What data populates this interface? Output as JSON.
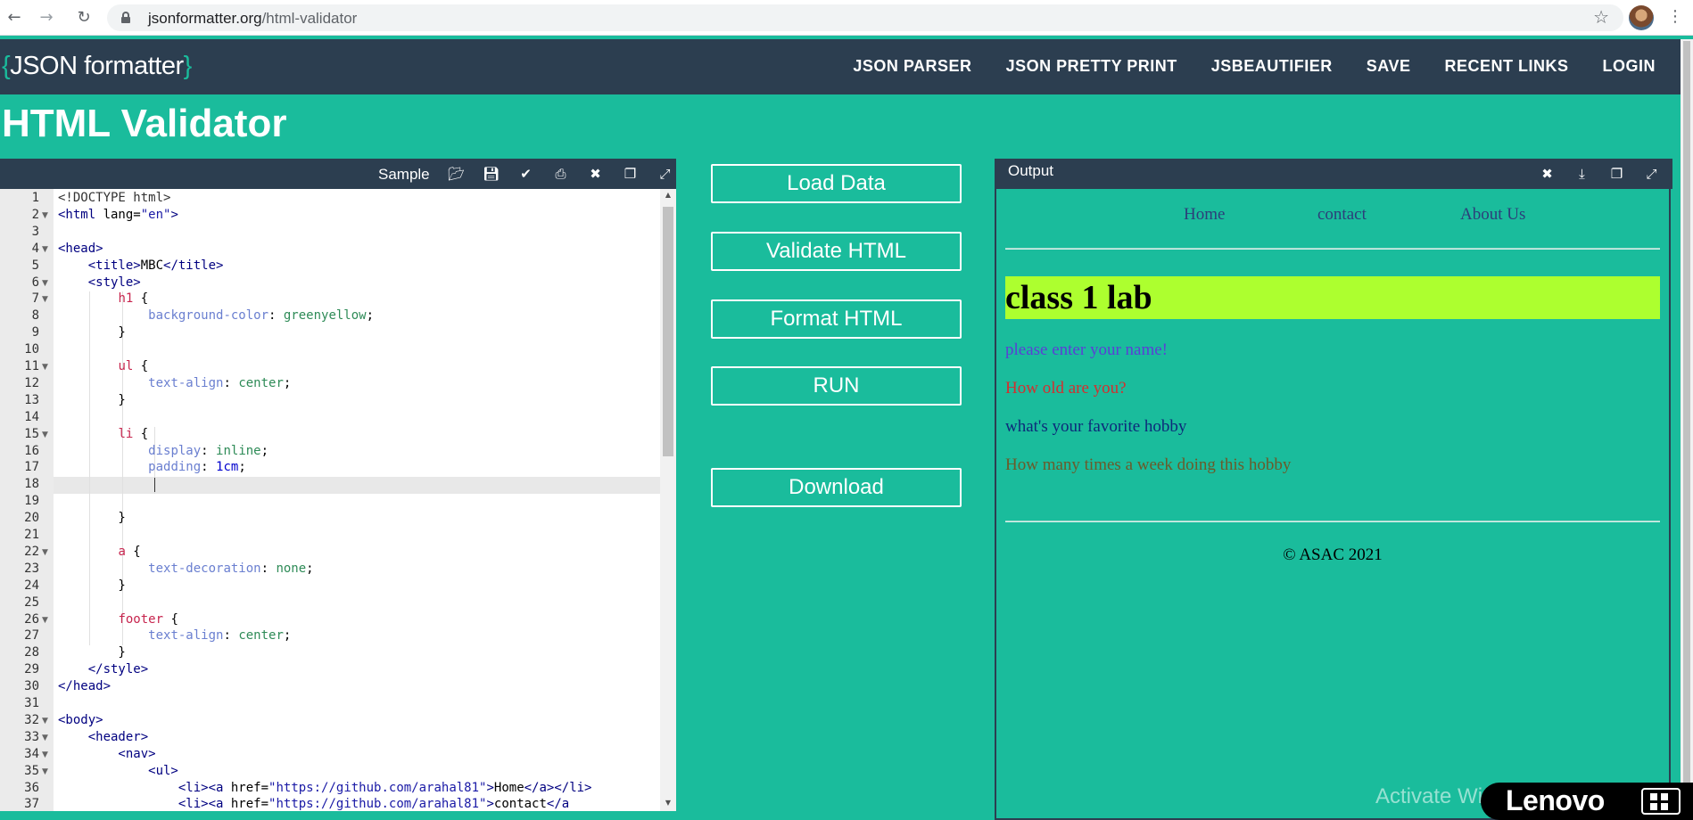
{
  "browser": {
    "url_domain": "jsonformatter.org",
    "url_path": "/html-validator"
  },
  "site": {
    "logo_open": "{",
    "logo_text": "JSON formatter",
    "logo_close": "}",
    "nav": [
      "JSON PARSER",
      "JSON PRETTY PRINT",
      "JSBEAUTIFIER",
      "SAVE",
      "RECENT LINKS",
      "LOGIN"
    ]
  },
  "page_title": "HTML Validator",
  "editor": {
    "toolbar_title": "Sample",
    "active_line": 18,
    "lines": [
      [
        [
          "t-doc",
          "<!DOCTYPE html>"
        ]
      ],
      [
        [
          "t-tag",
          "<html "
        ],
        [
          "t-attr",
          "lang="
        ],
        [
          "t-str",
          "\"en\""
        ],
        [
          "t-tag",
          ">"
        ]
      ],
      [],
      [
        [
          "t-tag",
          "<head>"
        ]
      ],
      [
        [
          "t-tag",
          "    <title>"
        ],
        [
          "t-attr",
          "MBC"
        ],
        [
          "t-tag",
          "</title>"
        ]
      ],
      [
        [
          "t-tag",
          "    <style>"
        ]
      ],
      [
        [
          "",
          "        "
        ],
        [
          "t-sel",
          "h1"
        ],
        [
          "t-attr",
          " {"
        ]
      ],
      [
        [
          "",
          "            "
        ],
        [
          "t-prop",
          "background-color"
        ],
        [
          "t-attr",
          ": "
        ],
        [
          "t-val",
          "greenyellow"
        ],
        [
          "t-attr",
          ";"
        ]
      ],
      [
        [
          "t-attr",
          "        }"
        ]
      ],
      [],
      [
        [
          "",
          "        "
        ],
        [
          "t-sel",
          "ul"
        ],
        [
          "t-attr",
          " {"
        ]
      ],
      [
        [
          "",
          "            "
        ],
        [
          "t-prop",
          "text-align"
        ],
        [
          "t-attr",
          ": "
        ],
        [
          "t-val",
          "center"
        ],
        [
          "t-attr",
          ";"
        ]
      ],
      [
        [
          "t-attr",
          "        }"
        ]
      ],
      [],
      [
        [
          "",
          "        "
        ],
        [
          "t-sel",
          "li"
        ],
        [
          "t-attr",
          " {"
        ]
      ],
      [
        [
          "",
          "            "
        ],
        [
          "t-prop",
          "display"
        ],
        [
          "t-attr",
          ": "
        ],
        [
          "t-val",
          "inline"
        ],
        [
          "t-attr",
          ";"
        ]
      ],
      [
        [
          "",
          "            "
        ],
        [
          "t-prop",
          "padding"
        ],
        [
          "t-attr",
          ": "
        ],
        [
          "t-num",
          "1cm"
        ],
        [
          "t-attr",
          ";"
        ]
      ],
      [],
      [],
      [
        [
          "t-attr",
          "        }"
        ]
      ],
      [],
      [
        [
          "",
          "        "
        ],
        [
          "t-sel",
          "a"
        ],
        [
          "t-attr",
          " {"
        ]
      ],
      [
        [
          "",
          "            "
        ],
        [
          "t-prop",
          "text-decoration"
        ],
        [
          "t-attr",
          ": "
        ],
        [
          "t-val",
          "none"
        ],
        [
          "t-attr",
          ";"
        ]
      ],
      [
        [
          "t-attr",
          "        }"
        ]
      ],
      [],
      [
        [
          "",
          "        "
        ],
        [
          "t-sel",
          "footer"
        ],
        [
          "t-attr",
          " {"
        ]
      ],
      [
        [
          "",
          "            "
        ],
        [
          "t-prop",
          "text-align"
        ],
        [
          "t-attr",
          ": "
        ],
        [
          "t-val",
          "center"
        ],
        [
          "t-attr",
          ";"
        ]
      ],
      [
        [
          "t-attr",
          "        }"
        ]
      ],
      [
        [
          "t-tag",
          "    </style>"
        ]
      ],
      [
        [
          "t-tag",
          "</head>"
        ]
      ],
      [],
      [
        [
          "t-tag",
          "<body>"
        ]
      ],
      [
        [
          "t-tag",
          "    <header>"
        ]
      ],
      [
        [
          "t-tag",
          "        <nav>"
        ]
      ],
      [
        [
          "t-tag",
          "            <ul>"
        ]
      ],
      [
        [
          "t-tag",
          "                <li><a "
        ],
        [
          "t-attr",
          "href="
        ],
        [
          "t-str",
          "\"https://github.com/arahal81\""
        ],
        [
          "t-tag",
          ">"
        ],
        [
          "t-attr",
          "Home"
        ],
        [
          "t-tag",
          "</a></li>"
        ]
      ],
      [
        [
          "t-tag",
          "                <li><a "
        ],
        [
          "t-attr",
          "href="
        ],
        [
          "t-str",
          "\"https://github.com/arahal81\""
        ],
        [
          "t-tag",
          ">"
        ],
        [
          "t-attr",
          "contact"
        ],
        [
          "t-tag",
          "</a"
        ]
      ]
    ],
    "fold_lines": [
      2,
      4,
      6,
      7,
      11,
      15,
      22,
      26,
      32,
      33,
      34,
      35
    ]
  },
  "actions": {
    "load": "Load Data",
    "validate": "Validate HTML",
    "format": "Format HTML",
    "run": "RUN",
    "download": "Download"
  },
  "output": {
    "toolbar_title": "Output",
    "nav": [
      "Home",
      "contact",
      "About Us"
    ],
    "heading": "class 1 lab",
    "paragraphs": [
      {
        "text": "please enter your name!",
        "color": "#5b3fd6"
      },
      {
        "text": "How old are you?",
        "color": "#d32f2f"
      },
      {
        "text": "what's your favorite hobby",
        "color": "#0d2a7a"
      },
      {
        "text": "How many times a week doing this hobby",
        "color": "#6b5a2a"
      }
    ],
    "footer": "© ASAC 2021"
  },
  "watermark": {
    "activate": "Activate Windows",
    "brand": "Lenovo"
  }
}
